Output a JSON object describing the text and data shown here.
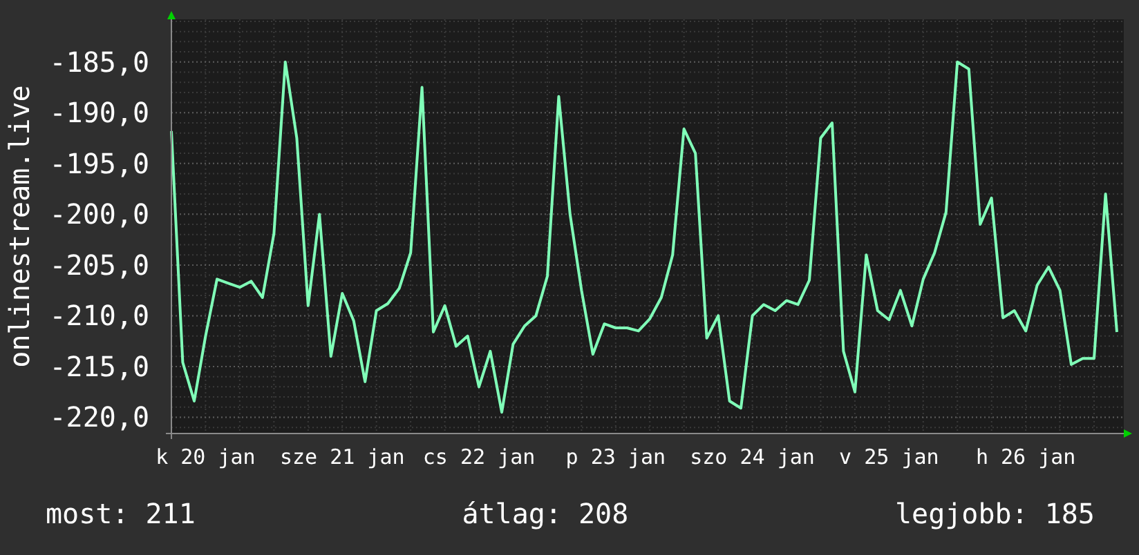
{
  "graph": {
    "chart_data": {
      "type": "line",
      "ylabel": "onlinestream.live",
      "ylim": [
        -221.6,
        -180.8
      ],
      "grid": true,
      "yticks": [
        {
          "value": -185,
          "label": "-185,0"
        },
        {
          "value": -190,
          "label": "-190,0"
        },
        {
          "value": -195,
          "label": "-195,0"
        },
        {
          "value": -200,
          "label": "-200,0"
        },
        {
          "value": -205,
          "label": "-205,0"
        },
        {
          "value": -210,
          "label": "-210,0"
        },
        {
          "value": -215,
          "label": "-215,0"
        },
        {
          "value": -220,
          "label": "-220,0"
        }
      ],
      "categories": [
        null,
        null,
        null,
        "k 20 jan",
        null,
        null,
        null,
        null,
        null,
        null,
        null,
        null,
        null,
        null,
        null,
        "sze 21 jan",
        null,
        null,
        null,
        null,
        null,
        null,
        null,
        null,
        null,
        null,
        null,
        "cs 22 jan",
        null,
        null,
        null,
        null,
        null,
        null,
        null,
        null,
        null,
        null,
        null,
        "p 23 jan",
        null,
        null,
        null,
        null,
        null,
        null,
        null,
        null,
        null,
        null,
        null,
        "szo 24 jan",
        null,
        null,
        null,
        null,
        null,
        null,
        null,
        null,
        null,
        null,
        null,
        "v 25 jan",
        null,
        null,
        null,
        null,
        null,
        null,
        null,
        null,
        null,
        null,
        null,
        "h 26 jan",
        null,
        null,
        null,
        null,
        null,
        null,
        null,
        null
      ],
      "series": [
        {
          "color": "#80ffb8",
          "values": [
            -191.8,
            -214.6,
            -218.4,
            -212,
            -206.4,
            -206.8,
            -207.2,
            -206.6,
            -208.2,
            -201.9,
            -185,
            -192.5,
            -209,
            -200,
            -214,
            -207.8,
            -210.5,
            -216.5,
            -209.5,
            -208.8,
            -207.3,
            -203.8,
            -187.5,
            -211.6,
            -209,
            -213,
            -212,
            -217,
            -213.5,
            -219.5,
            -212.8,
            -211,
            -210,
            -206.1,
            -188.4,
            -200,
            -207.5,
            -213.8,
            -210.8,
            -211.2,
            -211.2,
            -211.5,
            -210.3,
            -208.2,
            -204,
            -191.6,
            -194,
            -212.2,
            -210,
            -218.4,
            -219.1,
            -210,
            -208.9,
            -209.5,
            -208.5,
            -208.9,
            -206.5,
            -192.5,
            -191,
            -213.5,
            -217.5,
            -204,
            -209.5,
            -210.4,
            -207.5,
            -211,
            -206.4,
            -203.8,
            -199.8,
            -185,
            -185.7,
            -201,
            -198.4,
            -210.2,
            -209.5,
            -211.5,
            -207,
            -205.2,
            -207.5,
            -214.8,
            -214.2,
            -214.2,
            -198,
            -211.6
          ]
        }
      ]
    }
  },
  "legend": [
    {
      "text": "most: 211"
    },
    {
      "text": "átlag: 208"
    },
    {
      "text": "legjobb: 185"
    }
  ]
}
